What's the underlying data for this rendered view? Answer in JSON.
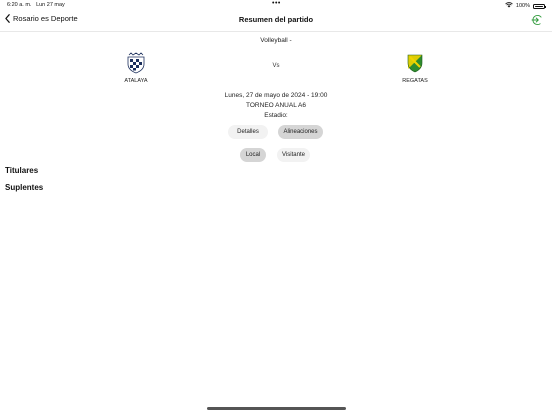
{
  "status_bar": {
    "time": "6:20 a. m.",
    "date": "Lun 27 may",
    "dots": "•••",
    "battery_pct": "100%"
  },
  "nav": {
    "back_label": "Rosario es Deporte",
    "title": "Resumen del partido"
  },
  "match": {
    "sport": "Volleyball -",
    "home_team": "ATALAYA",
    "away_team": "REGATAS",
    "vs": "Vs",
    "datetime": "Lunes, 27 de mayo de 2024 - 19:00",
    "tournament": "TORNEO ANUAL A6",
    "stadium": "Estadio:"
  },
  "tabs": {
    "details": "Detalles",
    "lineups": "Alineaciones",
    "selected": "Alineaciones"
  },
  "side_tabs": {
    "home": "Local",
    "away": "Visitante",
    "selected": "Local"
  },
  "sections": {
    "starters": "Titulares",
    "subs": "Suplentes"
  },
  "colors": {
    "pill_active": "#d5d5d5",
    "pill_inactive": "#f2f2f2",
    "accent_green": "#2e9a3a",
    "crest_navy": "#1c2f5c",
    "crest_green": "#2e8b2e",
    "crest_yellow": "#f2d400"
  }
}
